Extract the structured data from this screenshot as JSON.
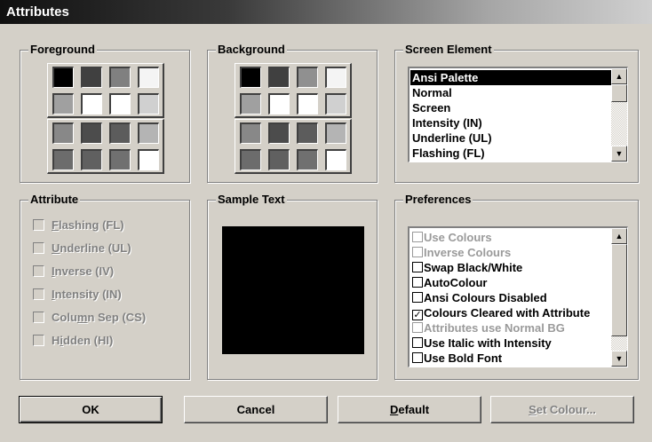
{
  "title": "Attributes",
  "foreground": {
    "title": "Foreground",
    "colors": [
      "#000000",
      "#404040",
      "#808080",
      "#f4f4f4",
      "#a0a0a0",
      "#ffffff",
      "#ffffff",
      "#d0d0d0",
      "#888888",
      "#4c4c4c",
      "#5c5c5c",
      "#b4b4b4",
      "#6c6c6c",
      "#606060",
      "#707070",
      "#ffffff"
    ]
  },
  "background": {
    "title": "Background",
    "colors": [
      "#000000",
      "#404040",
      "#909090",
      "#f4f4f4",
      "#a0a0a0",
      "#ffffff",
      "#ffffff",
      "#d0d0d0",
      "#888888",
      "#4c4c4c",
      "#5c5c5c",
      "#b4b4b4",
      "#6c6c6c",
      "#606060",
      "#707070",
      "#ffffff"
    ]
  },
  "screen_element": {
    "title": "Screen Element",
    "items": [
      "Ansi Palette",
      "Normal",
      "Screen",
      "Intensity (IN)",
      "Underline (UL)",
      "Flashing (FL)"
    ],
    "selected_index": 0
  },
  "attribute": {
    "title": "Attribute",
    "items": [
      {
        "pre": "",
        "key": "F",
        "post": "lashing (FL)"
      },
      {
        "pre": "",
        "key": "U",
        "post": "nderline (UL)"
      },
      {
        "pre": "",
        "key": "I",
        "post": "nverse (IV)"
      },
      {
        "pre": "",
        "key": "I",
        "post": "ntensity (IN)"
      },
      {
        "pre": "Colu",
        "key": "m",
        "post": "n Sep (CS)"
      },
      {
        "pre": "H",
        "key": "i",
        "post": "dden (HI)"
      }
    ]
  },
  "sample_text": {
    "title": "Sample Text",
    "color": "#000000"
  },
  "preferences": {
    "title": "Preferences",
    "items": [
      {
        "label": "Use Colours",
        "checked": false,
        "disabled": true
      },
      {
        "label": "Inverse Colours",
        "checked": false,
        "disabled": true
      },
      {
        "label": "Swap Black/White",
        "checked": false,
        "disabled": false
      },
      {
        "label": "AutoColour",
        "checked": false,
        "disabled": false
      },
      {
        "label": "Ansi Colours Disabled",
        "checked": false,
        "disabled": false
      },
      {
        "label": "Colours Cleared with Attribute",
        "checked": true,
        "disabled": false
      },
      {
        "label": "Attributes use Normal BG",
        "checked": false,
        "disabled": true
      },
      {
        "label": "Use Italic with Intensity",
        "checked": false,
        "disabled": false
      },
      {
        "label": "Use Bold Font",
        "checked": false,
        "disabled": false
      }
    ]
  },
  "buttons": {
    "ok": "OK",
    "cancel": "Cancel",
    "default": {
      "key": "D",
      "rest": "efault"
    },
    "set_colour": {
      "key": "S",
      "rest": "et Colour..."
    }
  },
  "icons": {
    "scroll_up": "up-arrow-icon",
    "scroll_down": "down-arrow-icon",
    "check": "checkmark-icon"
  }
}
